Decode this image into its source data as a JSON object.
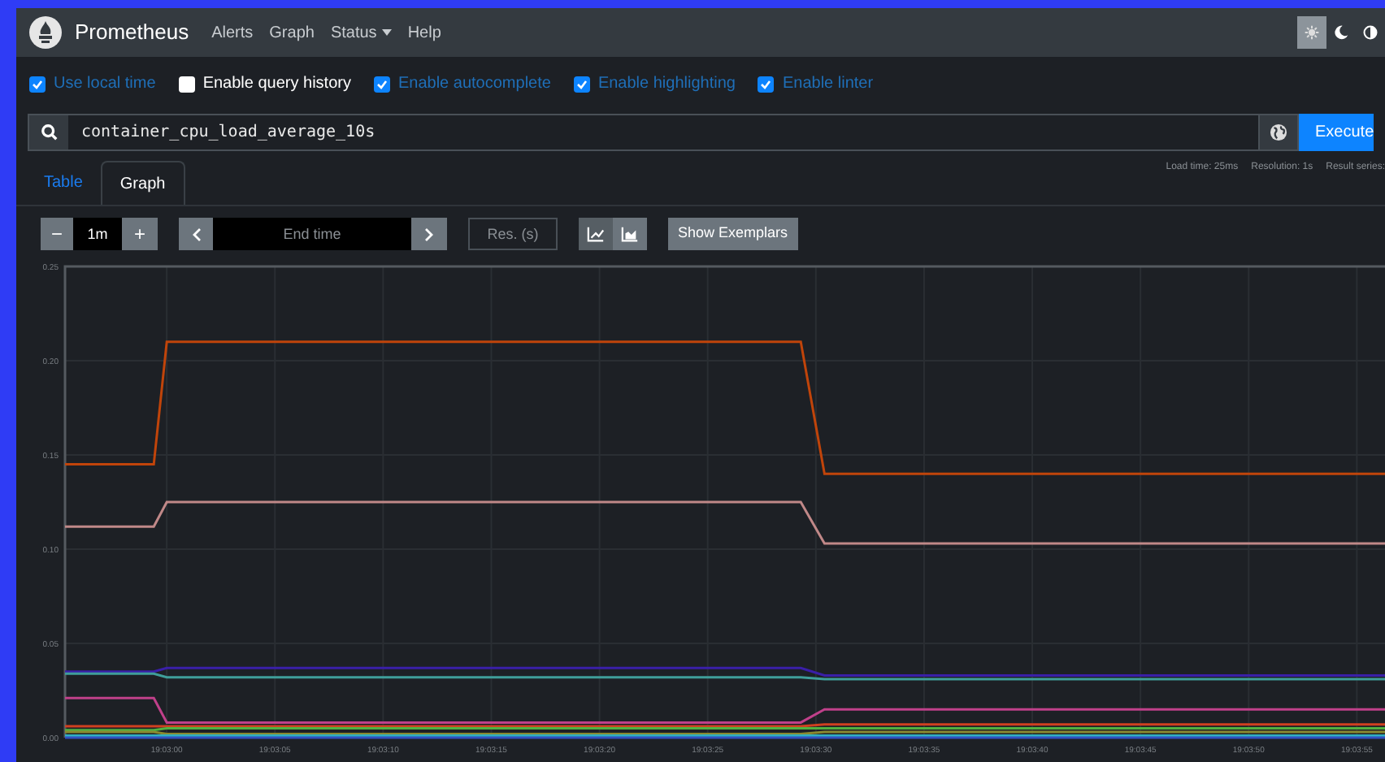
{
  "navbar": {
    "brand": "Prometheus",
    "items": [
      {
        "label": "Alerts",
        "dropdown": false
      },
      {
        "label": "Graph",
        "dropdown": false
      },
      {
        "label": "Status",
        "dropdown": true
      },
      {
        "label": "Help",
        "dropdown": false
      }
    ],
    "theme_buttons": [
      {
        "kind": "light",
        "selected": true
      },
      {
        "kind": "dark",
        "selected": false
      },
      {
        "kind": "auto",
        "selected": false
      }
    ]
  },
  "options": [
    {
      "label": "Use local time",
      "checked": true
    },
    {
      "label": "Enable query history",
      "checked": false
    },
    {
      "label": "Enable autocomplete",
      "checked": true
    },
    {
      "label": "Enable highlighting",
      "checked": true
    },
    {
      "label": "Enable linter",
      "checked": true
    }
  ],
  "query": {
    "value": "container_cpu_load_average_10s",
    "execute": "Execute"
  },
  "tabs": [
    {
      "label": "Table",
      "selected": false
    },
    {
      "label": "Graph",
      "selected": true
    }
  ],
  "stats": [
    "Load time: 25ms",
    "Resolution: 1s",
    "Result series:"
  ],
  "controls": {
    "decrease": "−",
    "range": "1m",
    "increase": "+",
    "end_time_placeholder": "End time",
    "resolution_placeholder": "Res. (s)",
    "chart_modes": [
      {
        "kind": "line",
        "selected": true
      },
      {
        "kind": "stacked",
        "selected": false
      }
    ],
    "exemplars": "Show Exemplars"
  },
  "graph": {
    "chart_data": {
      "type": "line",
      "grid": true,
      "x": [
        68575.3,
        68579.4,
        68580,
        68609.3,
        68610.4,
        68636.3
      ],
      "xlim": [
        68575.3,
        68636.3
      ],
      "ylim": [
        0,
        0.25
      ],
      "xticks": [
        {
          "value": 68580,
          "label": "19:03:00"
        },
        {
          "value": 68585,
          "label": "19:03:05"
        },
        {
          "value": 68590,
          "label": "19:03:10"
        },
        {
          "value": 68595,
          "label": "19:03:15"
        },
        {
          "value": 68600,
          "label": "19:03:20"
        },
        {
          "value": 68605,
          "label": "19:03:25"
        },
        {
          "value": 68610,
          "label": "19:03:30"
        },
        {
          "value": 68615,
          "label": "19:03:35"
        },
        {
          "value": 68620,
          "label": "19:03:40"
        },
        {
          "value": 68625,
          "label": "19:03:45"
        },
        {
          "value": 68630,
          "label": "19:03:50"
        },
        {
          "value": 68635,
          "label": "19:03:55"
        }
      ],
      "yticks": [
        {
          "value": 0,
          "label": "0.00"
        },
        {
          "value": 0.05,
          "label": "0.05"
        },
        {
          "value": 0.1,
          "label": "0.10"
        },
        {
          "value": 0.15,
          "label": "0.15"
        },
        {
          "value": 0.2,
          "label": "0.20"
        },
        {
          "value": 0.25,
          "label": "0.25"
        }
      ],
      "series": [
        {
          "color": "#c0440a",
          "values": [
            0.145,
            0.145,
            0.21,
            0.21,
            0.14,
            0.14
          ]
        },
        {
          "color": "#c08888",
          "values": [
            0.112,
            0.112,
            0.125,
            0.125,
            0.103,
            0.103
          ]
        },
        {
          "color": "#3a1fa8",
          "values": [
            0.035,
            0.035,
            0.037,
            0.037,
            0.033,
            0.033
          ]
        },
        {
          "color": "#3f9e9a",
          "values": [
            0.034,
            0.034,
            0.032,
            0.032,
            0.031,
            0.031
          ]
        },
        {
          "color": "#c0408a",
          "values": [
            0.021,
            0.021,
            0.008,
            0.008,
            0.015,
            0.015
          ]
        },
        {
          "color": "#d04020",
          "values": [
            0.006,
            0.006,
            0.006,
            0.006,
            0.007,
            0.007
          ]
        },
        {
          "color": "#50b040",
          "values": [
            0.004,
            0.004,
            0.005,
            0.005,
            0.005,
            0.005
          ]
        },
        {
          "color": "#8a8a30",
          "values": [
            0.003,
            0.003,
            0.002,
            0.002,
            0.003,
            0.003
          ]
        },
        {
          "color": "#30b0c0",
          "values": [
            0.001,
            0.001,
            0.001,
            0.001,
            0.001,
            0.001
          ]
        },
        {
          "color": "#3050c0",
          "values": [
            0,
            0,
            0,
            0,
            0,
            0
          ]
        }
      ]
    }
  }
}
